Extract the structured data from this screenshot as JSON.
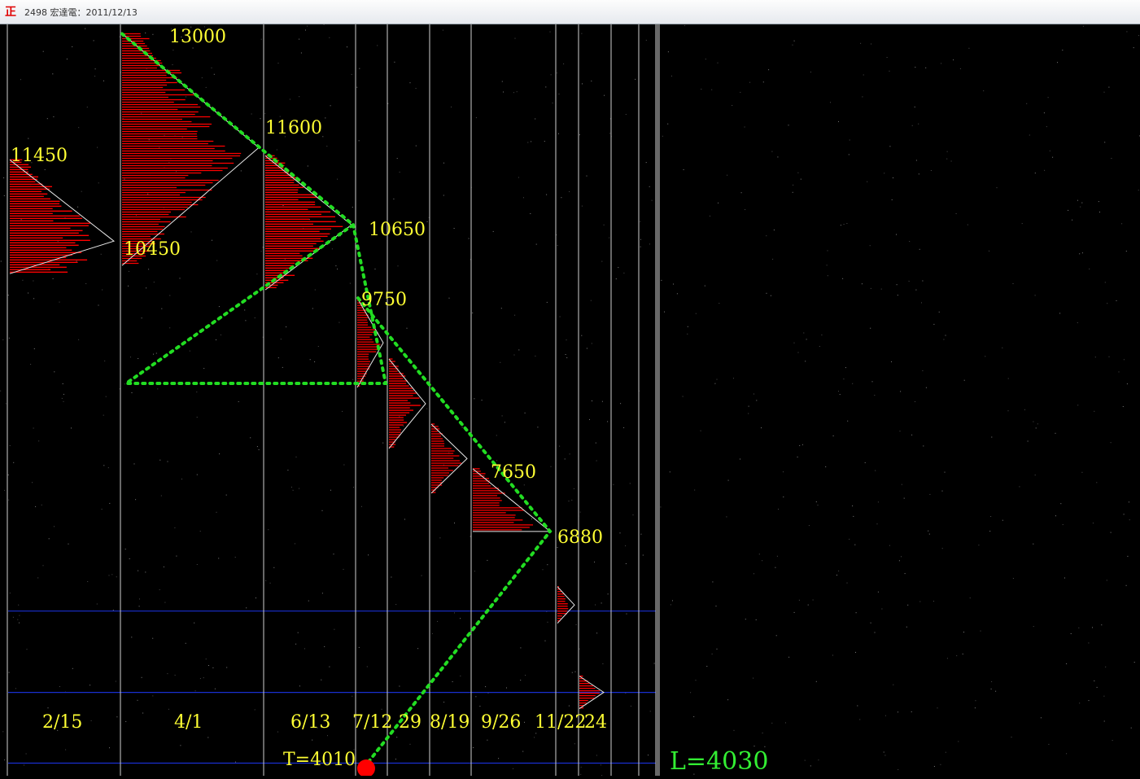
{
  "window": {
    "title": "2498 宏達電：2011/12/13",
    "icon": "正"
  },
  "colors": {
    "background": "#000000",
    "histogram": "#ff0000",
    "trend": "#22dd22",
    "labels": "#ffff33",
    "separator": "#cfcfcf",
    "level": "#1a2fd0",
    "marker": "#ff0000"
  },
  "chart_data": {
    "type": "volume-profile",
    "title": "",
    "dates": [
      "2/15",
      "4/1",
      "6/13",
      "7/12",
      "29",
      "8/19",
      "9/26",
      "11/22",
      "24"
    ],
    "profiles": [
      {
        "date": "2/15",
        "high": 11450,
        "low": 10050,
        "apex": 10450
      },
      {
        "date": "4/1",
        "high": 13000,
        "low": 10150,
        "apex": 11600
      },
      {
        "date": "6/13",
        "high": 11500,
        "low": 9850,
        "apex": 10650
      },
      {
        "date": "7/12",
        "high": 9750,
        "low": 8650
      },
      {
        "date": "29",
        "high": 9000,
        "low": 7900
      },
      {
        "date": "8/19",
        "high": 8200,
        "low": 7350
      },
      {
        "date": "9/26",
        "high": 7650,
        "low": 6880,
        "apex": 6880
      },
      {
        "date": "11/22",
        "high": 6200,
        "low": 5750
      },
      {
        "date": "24",
        "high": 5100,
        "low": 4700
      }
    ],
    "price_labels": [
      "13000",
      "11600",
      "11450",
      "10450",
      "10650",
      "9750",
      "7650",
      "6880"
    ],
    "trend_path": [
      13000,
      10650,
      8700,
      10650,
      9750,
      6880,
      4010
    ],
    "levels": [
      5900,
      4900,
      4030
    ],
    "target_label": "T=4010",
    "target": 4010,
    "low_label": "L=4030",
    "low": 4030
  }
}
